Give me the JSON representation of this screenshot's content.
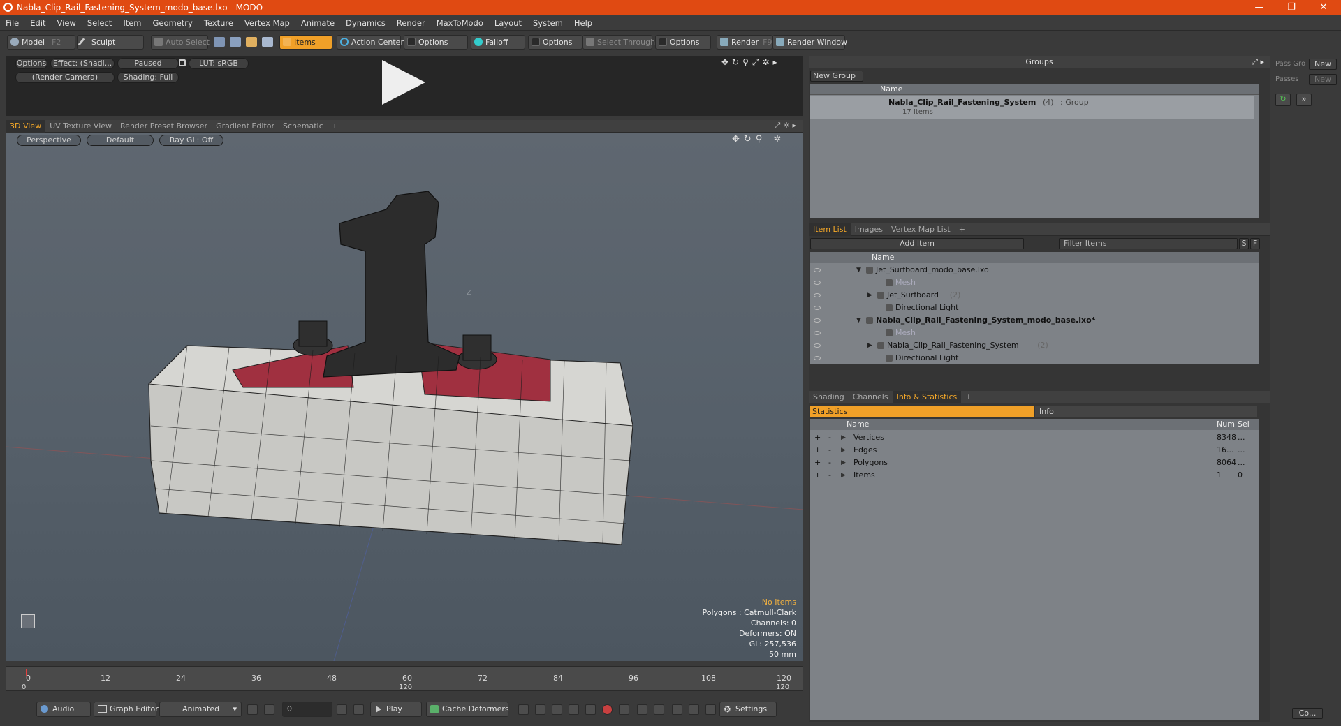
{
  "window": {
    "title": "Nabla_Clip_Rail_Fastening_System_modo_base.lxo - MODO",
    "min": "—",
    "max": "❐",
    "close": "✕"
  },
  "menu": [
    "File",
    "Edit",
    "View",
    "Select",
    "Item",
    "Geometry",
    "Texture",
    "Vertex Map",
    "Animate",
    "Dynamics",
    "Render",
    "MaxToModo",
    "Layout",
    "System",
    "Help"
  ],
  "toolbar": {
    "model": "Model",
    "model_key": "F2",
    "sculpt": "Sculpt",
    "auto_select": "Auto Select",
    "items": "Items",
    "action_center": "Action Center",
    "options": "Options",
    "falloff": "Falloff",
    "select_through": "Select Through",
    "render": "Render",
    "render_key": "F9",
    "render_window": "Render Window"
  },
  "preview": {
    "options": "Options",
    "effect": "Effect: (Shadi...",
    "paused": "Paused",
    "lut": "LUT: sRGB",
    "camera": "(Render Camera)",
    "shading": "Shading: Full"
  },
  "viewtabs": [
    "3D View",
    "UV Texture View",
    "Render Preset Browser",
    "Gradient Editor",
    "Schematic",
    "+"
  ],
  "viewport": {
    "projection": "Perspective",
    "style": "Default",
    "raygl": "Ray GL: Off",
    "z_label": "Z",
    "hud_noitems": "No Items",
    "hud_lines": [
      "Polygons : Catmull-Clark",
      "Channels: 0",
      "Deformers: ON",
      "GL: 257,536",
      "50 mm"
    ]
  },
  "timeline": {
    "ticks": [
      "0",
      "12",
      "24",
      "36",
      "48",
      "60",
      "72",
      "84",
      "96",
      "108",
      "120"
    ],
    "sub_left": "0",
    "sub_mid": "120",
    "sub_right": "120"
  },
  "bottom": {
    "audio": "Audio",
    "graph_editor": "Graph Editor",
    "animated": "Animated",
    "frame": "0",
    "play": "Play",
    "cache": "Cache Deformers",
    "settings": "Settings"
  },
  "groups": {
    "title": "Groups",
    "new_group": "New Group",
    "col_name": "Name",
    "item_name": "Nabla_Clip_Rail_Fastening_System",
    "item_count": "(4)",
    "item_type": ": Group",
    "item_sub": "17 Items"
  },
  "passes": {
    "pass_label": "Pass Gro",
    "new": "New",
    "passes_label": "Passes",
    "new2": "New",
    "bottom_btn": "Co..."
  },
  "itemlist": {
    "tabs": [
      "Item List",
      "Images",
      "Vertex Map List",
      "+"
    ],
    "add_item": "Add Item",
    "filter": "Filter Items",
    "s": "S",
    "f": "F",
    "col_name": "Name",
    "rows": [
      {
        "label": "Jet_Surfboard_modo_base.lxo",
        "extra": "",
        "indent": 0,
        "arrow": "▼",
        "dim": false,
        "bold": false
      },
      {
        "label": "Mesh",
        "extra": "",
        "indent": 2,
        "arrow": "",
        "dim": true,
        "bold": false
      },
      {
        "label": "Jet_Surfboard",
        "extra": "(2)",
        "indent": 1,
        "arrow": "▶",
        "dim": false,
        "bold": false
      },
      {
        "label": "Directional Light",
        "extra": "",
        "indent": 2,
        "arrow": "",
        "dim": false,
        "bold": false
      },
      {
        "label": "Nabla_Clip_Rail_Fastening_System_modo_base.lxo*",
        "extra": "",
        "indent": 0,
        "arrow": "▼",
        "dim": false,
        "bold": true
      },
      {
        "label": "Mesh",
        "extra": "",
        "indent": 2,
        "arrow": "",
        "dim": true,
        "bold": false
      },
      {
        "label": "Nabla_Clip_Rail_Fastening_System",
        "extra": "(2)",
        "indent": 1,
        "arrow": "▶",
        "dim": false,
        "bold": false
      },
      {
        "label": "Directional Light",
        "extra": "",
        "indent": 2,
        "arrow": "",
        "dim": false,
        "bold": false
      }
    ]
  },
  "stats": {
    "tabs": [
      "Shading",
      "Channels",
      "Info & Statistics",
      "+"
    ],
    "statistics": "Statistics",
    "info": "Info",
    "col_name": "Name",
    "col_num": "Num",
    "col_sel": "Sel",
    "rows": [
      {
        "name": "Vertices",
        "num": "8348",
        "sel": "..."
      },
      {
        "name": "Edges",
        "num": "16...",
        "sel": "..."
      },
      {
        "name": "Polygons",
        "num": "8064",
        "sel": "..."
      },
      {
        "name": "Items",
        "num": "1",
        "sel": "0"
      }
    ]
  }
}
